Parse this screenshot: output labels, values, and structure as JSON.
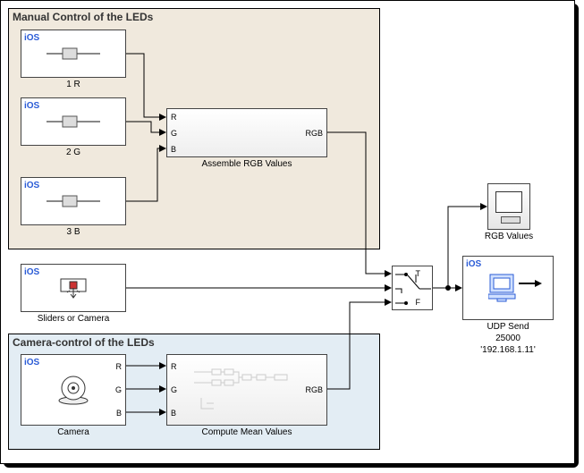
{
  "regions": {
    "manual": {
      "title": "Manual Control of the LEDs"
    },
    "camera": {
      "title": "Camera-control of the LEDs"
    }
  },
  "blocks": {
    "slider1": {
      "badge": "iOS",
      "label": "1 R"
    },
    "slider2": {
      "badge": "iOS",
      "label": "2 G"
    },
    "slider3": {
      "badge": "iOS",
      "label": "3 B"
    },
    "assemble": {
      "label": "Assemble RGB Values",
      "in": [
        "R",
        "G",
        "B"
      ],
      "out": "RGB"
    },
    "switchSrc": {
      "badge": "iOS",
      "label": "Sliders or Camera"
    },
    "cameraBlk": {
      "badge": "iOS",
      "label": "Camera",
      "out": [
        "R",
        "G",
        "B"
      ]
    },
    "compute": {
      "label": "Compute Mean Values",
      "in": [
        "R",
        "G",
        "B"
      ],
      "out": "RGB"
    },
    "switch": {
      "t": "T",
      "f": "F"
    },
    "scope": {
      "label": "RGB Values"
    },
    "udp": {
      "badge": "iOS",
      "label": "UDP Send",
      "port": "25000",
      "ip": "'192.168.1.11'"
    }
  }
}
